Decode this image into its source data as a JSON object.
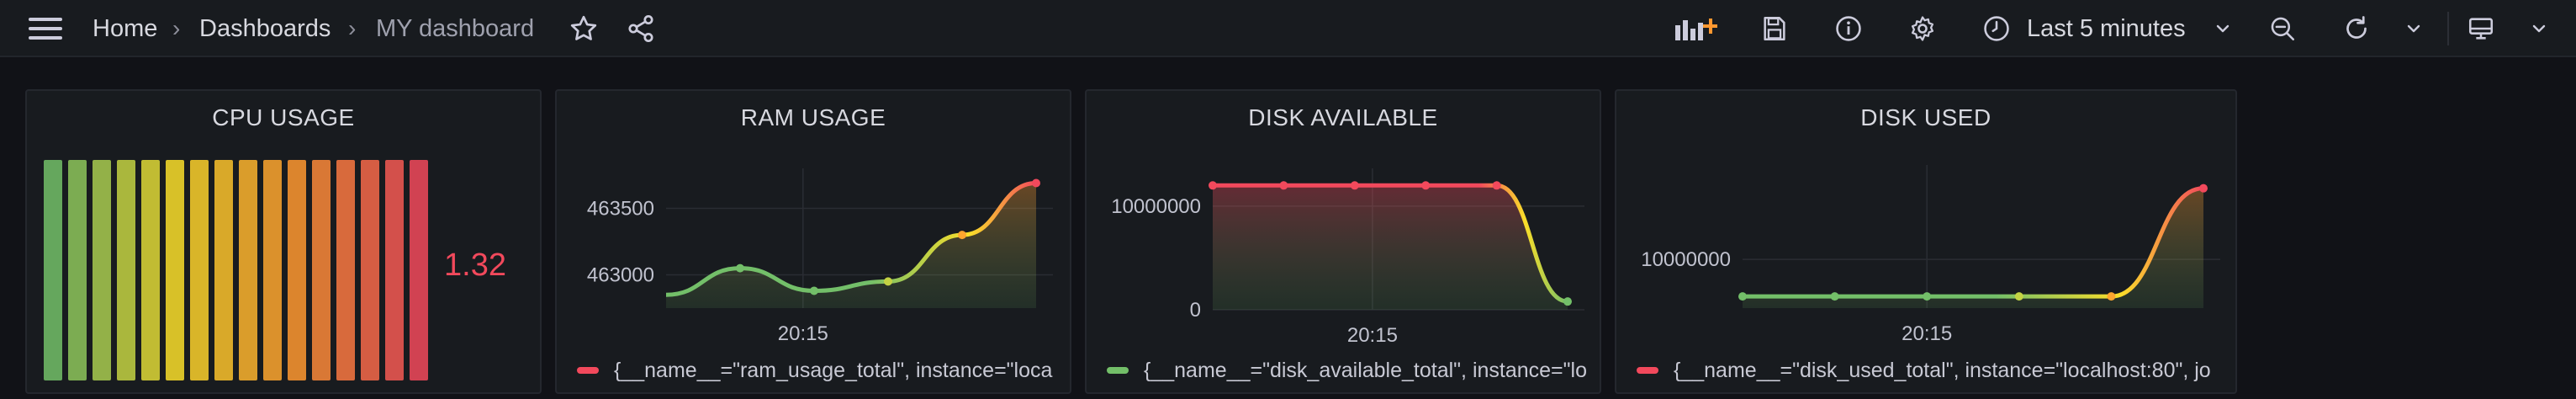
{
  "breadcrumb": {
    "home": "Home",
    "dashboards": "Dashboards",
    "current": "MY dashboard",
    "separator": "›"
  },
  "toolbar": {
    "time_range": "Last 5 minutes",
    "icons": [
      "menu-icon",
      "star-icon",
      "share-icon",
      "add-panel-icon",
      "save-icon",
      "info-icon",
      "settings-icon",
      "clock-icon",
      "chevron-down-icon",
      "zoom-out-icon",
      "refresh-icon",
      "tv-mode-icon"
    ]
  },
  "colors": {
    "red": "#f2495c",
    "green": "#73bf69",
    "yellow": "#fade2a",
    "orange": "#ff9830"
  },
  "panels": [
    {
      "title": "CPU USAGE",
      "value": "1.32",
      "bar_segments": 16,
      "bar_level": 1.0
    },
    {
      "title": "RAM USAGE",
      "legend": "{__name__=\"ram_usage_total\", instance=\"loca",
      "legend_color": "#f2495c"
    },
    {
      "title": "DISK AVAILABLE",
      "legend": "{__name__=\"disk_available_total\", instance=\"lo",
      "legend_color": "#73bf69"
    },
    {
      "title": "DISK USED",
      "legend": "{__name__=\"disk_used_total\", instance=\"localhost:80\", jo",
      "legend_color": "#f2495c"
    }
  ],
  "chart_data": [
    {
      "type": "line",
      "title": "RAM USAGE",
      "x": [
        "",
        "",
        "20:15",
        "",
        "",
        ""
      ],
      "xticks": [
        "20:15"
      ],
      "yticks": [
        463000,
        463500
      ],
      "series": [
        {
          "values": [
            462850,
            463050,
            462880,
            462950,
            463300,
            463690
          ]
        }
      ]
    },
    {
      "type": "line",
      "title": "DISK AVAILABLE",
      "xticks": [
        "20:15"
      ],
      "yticks": [
        0,
        10000000
      ],
      "series": [
        {
          "values": [
            12000000,
            12000000,
            12000000,
            12000000,
            12000000,
            800000
          ]
        }
      ]
    },
    {
      "type": "line",
      "title": "DISK USED",
      "xticks": [
        "20:15"
      ],
      "yticks": [
        10000000
      ],
      "series": [
        {
          "values": [
            6200000,
            6200000,
            6200000,
            6200000,
            6200000,
            17300000
          ]
        }
      ]
    }
  ]
}
